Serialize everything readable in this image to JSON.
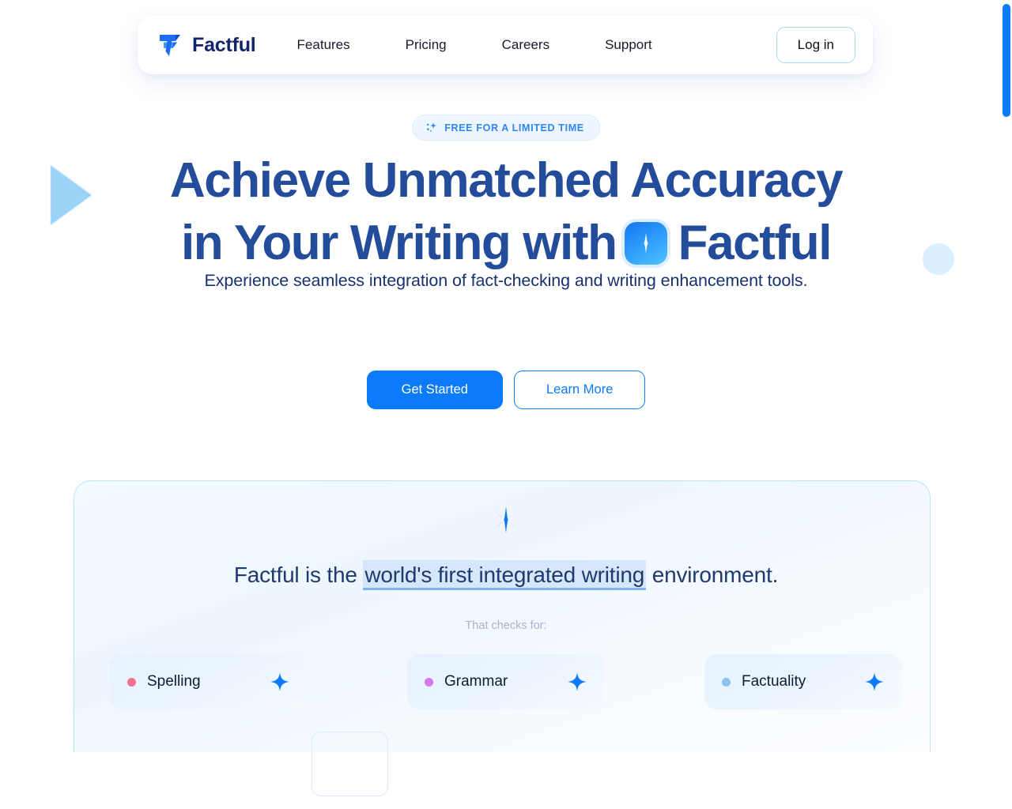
{
  "brand": {
    "name": "Factful",
    "logo_icon": "factful-f-logo-icon"
  },
  "nav": {
    "links": [
      {
        "label": "Features"
      },
      {
        "label": "Pricing"
      },
      {
        "label": "Careers"
      },
      {
        "label": "Support"
      }
    ],
    "login_label": "Log in"
  },
  "hero": {
    "badge": {
      "icon": "sparkles-icon",
      "text": "FREE FOR A LIMITED TIME"
    },
    "headline_line1": "Achieve Unmatched Accuracy",
    "headline_line2_before": "in Your Writing with",
    "headline_line2_after": "Factful",
    "headline_icon": "star-sparkle-icon",
    "subtitle": "Experience seamless integration of fact-checking and writing enhancement tools.",
    "cta_primary": "Get Started",
    "cta_secondary": "Learn More"
  },
  "showcase": {
    "star_icon": "sparkle-star-icon",
    "sentence_before": "Factful is the",
    "sentence_highlight": "world's first integrated writing",
    "sentence_after": "environment.",
    "checks_label": "That checks for:",
    "pills": [
      {
        "label": "Spelling",
        "dot_color": "#f2708f",
        "star_icon": "sparkle-icon"
      },
      {
        "label": "Grammar",
        "dot_color": "#d777f0",
        "star_icon": "sparkle-icon"
      },
      {
        "label": "Factuality",
        "dot_color": "#8cc2f2",
        "star_icon": "sparkle-icon"
      }
    ]
  },
  "colors": {
    "accent_blue": "#0b7afb",
    "headline_blue": "#234c9b",
    "brand_navy": "#12256b",
    "card_border": "#b9e6f7",
    "selection_highlight": "#d6e6fb"
  },
  "scrollbar": {
    "name": "vertical-scrollbar"
  }
}
